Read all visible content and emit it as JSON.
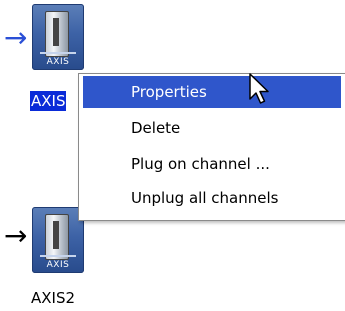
{
  "nodes": [
    {
      "arrow_icon": "arrow-right-icon",
      "icon_caption": "AXIS",
      "label": "AXIS",
      "selected": true,
      "arrow_color": "#2a4fd6"
    },
    {
      "arrow_icon": "arrow-right-icon",
      "icon_caption": "AXIS",
      "label": "AXIS2",
      "selected": false,
      "arrow_color": "#000000"
    }
  ],
  "context_menu": {
    "items": [
      {
        "label": "Properties",
        "highlighted": true
      },
      {
        "label": "Delete",
        "highlighted": false
      },
      {
        "label": "Plug on channel ...",
        "highlighted": false
      },
      {
        "label": "Unplug all channels",
        "highlighted": false
      }
    ]
  },
  "colors": {
    "selection_blue": "#2f56cb",
    "label_selection_blue": "#0a2bd8",
    "icon_blue": "#3d62a6"
  },
  "cursor_icon": "mouse-pointer-icon"
}
